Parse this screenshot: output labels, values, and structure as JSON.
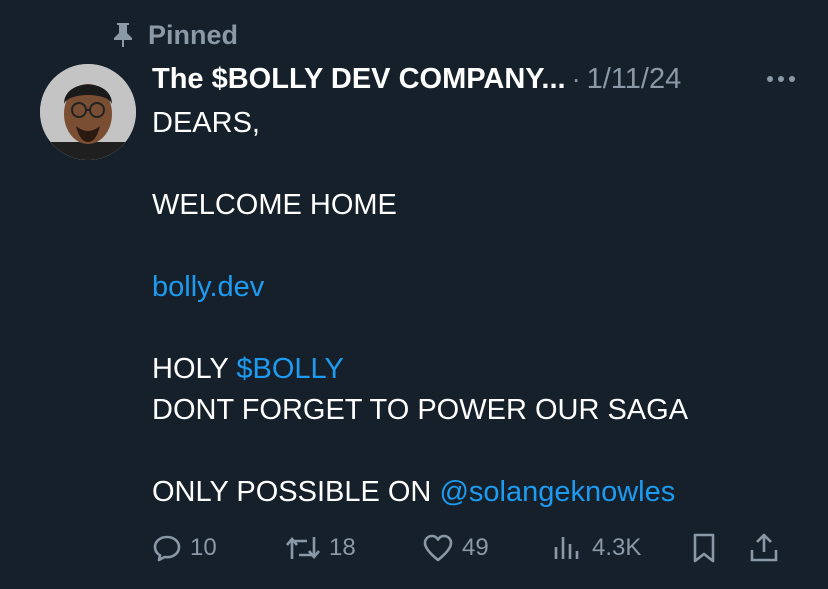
{
  "pinned": {
    "label": "Pinned",
    "icon": "pin-icon"
  },
  "post": {
    "author_name": "The $BOLLY DEV COMPANY...",
    "separator": "·",
    "date": "1/11/24",
    "body": {
      "line1": "DEARS,",
      "line2": "WELCOME HOME",
      "link_url": "bolly.dev",
      "holy_text": "HOLY ",
      "cashtag": "$BOLLY",
      "line5": "DONT FORGET TO POWER OUR SAGA",
      "only_text": "ONLY POSSIBLE ON ",
      "mention": "@solangeknowles"
    }
  },
  "actions": {
    "replies": "10",
    "reposts": "18",
    "likes": "49",
    "views": "4.3K"
  },
  "colors": {
    "background": "#15202b",
    "text": "#ffffff",
    "muted": "#8b98a5",
    "link": "#1d9bf0"
  }
}
